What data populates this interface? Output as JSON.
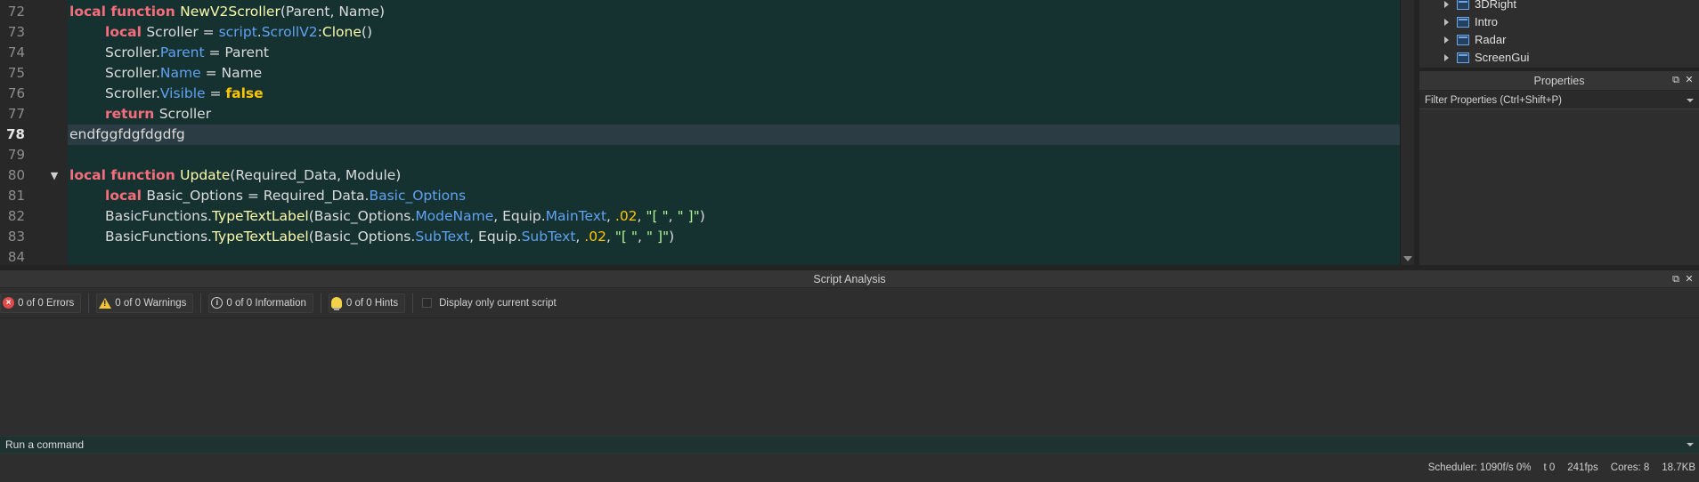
{
  "editor": {
    "lines": [
      {
        "num": "72",
        "indent": 0,
        "fold": "",
        "tokens": [
          {
            "t": "local ",
            "c": "kw"
          },
          {
            "t": "function ",
            "c": "kw"
          },
          {
            "t": "NewV2Scroller",
            "c": "fn"
          },
          {
            "t": "(Parent, Name)",
            "c": "plain"
          }
        ]
      },
      {
        "num": "73",
        "indent": 1,
        "fold": "",
        "tokens": [
          {
            "t": "local ",
            "c": "kw"
          },
          {
            "t": "Scroller = ",
            "c": "plain"
          },
          {
            "t": "script",
            "c": "prop"
          },
          {
            "t": ".",
            "c": "plain"
          },
          {
            "t": "ScrollV2",
            "c": "prop"
          },
          {
            "t": ":",
            "c": "plain"
          },
          {
            "t": "Clone",
            "c": "fn"
          },
          {
            "t": "()",
            "c": "plain"
          }
        ]
      },
      {
        "num": "74",
        "indent": 1,
        "fold": "",
        "tokens": [
          {
            "t": "Scroller.",
            "c": "plain"
          },
          {
            "t": "Parent",
            "c": "prop"
          },
          {
            "t": " = Parent",
            "c": "plain"
          }
        ]
      },
      {
        "num": "75",
        "indent": 1,
        "fold": "",
        "tokens": [
          {
            "t": "Scroller.",
            "c": "plain"
          },
          {
            "t": "Name",
            "c": "prop"
          },
          {
            "t": " = Name",
            "c": "plain"
          }
        ]
      },
      {
        "num": "76",
        "indent": 1,
        "fold": "",
        "tokens": [
          {
            "t": "Scroller.",
            "c": "plain"
          },
          {
            "t": "Visible",
            "c": "prop"
          },
          {
            "t": " = ",
            "c": "plain"
          },
          {
            "t": "false",
            "c": "bool"
          }
        ]
      },
      {
        "num": "77",
        "indent": 1,
        "fold": "",
        "tokens": [
          {
            "t": "return ",
            "c": "kw"
          },
          {
            "t": "Scroller",
            "c": "plain"
          }
        ]
      },
      {
        "num": "78",
        "indent": 0,
        "fold": "",
        "current": true,
        "tokens": [
          {
            "t": "endfggfdgfdgdfg",
            "c": "plain"
          }
        ]
      },
      {
        "num": "79",
        "indent": 0,
        "fold": "",
        "tokens": []
      },
      {
        "num": "80",
        "indent": 0,
        "fold": "▼",
        "tokens": [
          {
            "t": "local ",
            "c": "kw"
          },
          {
            "t": "function ",
            "c": "kw"
          },
          {
            "t": "Update",
            "c": "fn"
          },
          {
            "t": "(Required_Data, Module)",
            "c": "plain"
          }
        ]
      },
      {
        "num": "81",
        "indent": 1,
        "fold": "",
        "tokens": [
          {
            "t": "local ",
            "c": "kw"
          },
          {
            "t": "Basic_Options = Required_Data.",
            "c": "plain"
          },
          {
            "t": "Basic_Options",
            "c": "prop"
          }
        ]
      },
      {
        "num": "82",
        "indent": 1,
        "fold": "",
        "tokens": [
          {
            "t": "BasicFunctions.",
            "c": "plain"
          },
          {
            "t": "TypeTextLabel",
            "c": "fn"
          },
          {
            "t": "(Basic_Options.",
            "c": "plain"
          },
          {
            "t": "ModeName",
            "c": "prop"
          },
          {
            "t": ", Equip.",
            "c": "plain"
          },
          {
            "t": "MainText",
            "c": "prop"
          },
          {
            "t": ", ",
            "c": "plain"
          },
          {
            "t": ".02",
            "c": "num"
          },
          {
            "t": ", ",
            "c": "plain"
          },
          {
            "t": "\"[ \"",
            "c": "str"
          },
          {
            "t": ", ",
            "c": "plain"
          },
          {
            "t": "\" ]\"",
            "c": "str"
          },
          {
            "t": ")",
            "c": "plain"
          }
        ]
      },
      {
        "num": "83",
        "indent": 1,
        "fold": "",
        "tokens": [
          {
            "t": "BasicFunctions.",
            "c": "plain"
          },
          {
            "t": "TypeTextLabel",
            "c": "fn"
          },
          {
            "t": "(Basic_Options.",
            "c": "plain"
          },
          {
            "t": "SubText",
            "c": "prop"
          },
          {
            "t": ", Equip.",
            "c": "plain"
          },
          {
            "t": "SubText",
            "c": "prop"
          },
          {
            "t": ", ",
            "c": "plain"
          },
          {
            "t": ".02",
            "c": "num"
          },
          {
            "t": ", ",
            "c": "plain"
          },
          {
            "t": "\"[ \"",
            "c": "str"
          },
          {
            "t": ", ",
            "c": "plain"
          },
          {
            "t": "\" ]\"",
            "c": "str"
          },
          {
            "t": ")",
            "c": "plain"
          }
        ]
      },
      {
        "num": "84",
        "indent": 0,
        "fold": "",
        "tokens": []
      }
    ]
  },
  "explorer": {
    "items": [
      {
        "label": "3DRight",
        "icon": "screen-gui-icon"
      },
      {
        "label": "Intro",
        "icon": "screen-gui-icon"
      },
      {
        "label": "Radar",
        "icon": "screen-gui-icon"
      },
      {
        "label": "ScreenGui",
        "icon": "screen-gui-icon"
      }
    ]
  },
  "properties": {
    "title": "Properties",
    "filter_placeholder": "Filter Properties (Ctrl+Shift+P)"
  },
  "analysis": {
    "title": "Script Analysis",
    "errors": "0 of 0 Errors",
    "warnings": "0 of 0 Warnings",
    "information": "0 of 0 Information",
    "hints": "0 of 0 Hints",
    "display_only_current": "Display only current script"
  },
  "command_bar": {
    "placeholder": "Run a command"
  },
  "status": {
    "scheduler": "Scheduler: 1090f/s 0%",
    "t": "t 0",
    "fps": "241fps",
    "cores": "Cores: 8",
    "memory": "18.7KB"
  },
  "icons": {
    "dock": "undock-icon",
    "close": "close-icon",
    "error": "error-icon",
    "warning": "warning-icon",
    "info": "info-icon",
    "hint": "lightbulb-icon"
  }
}
